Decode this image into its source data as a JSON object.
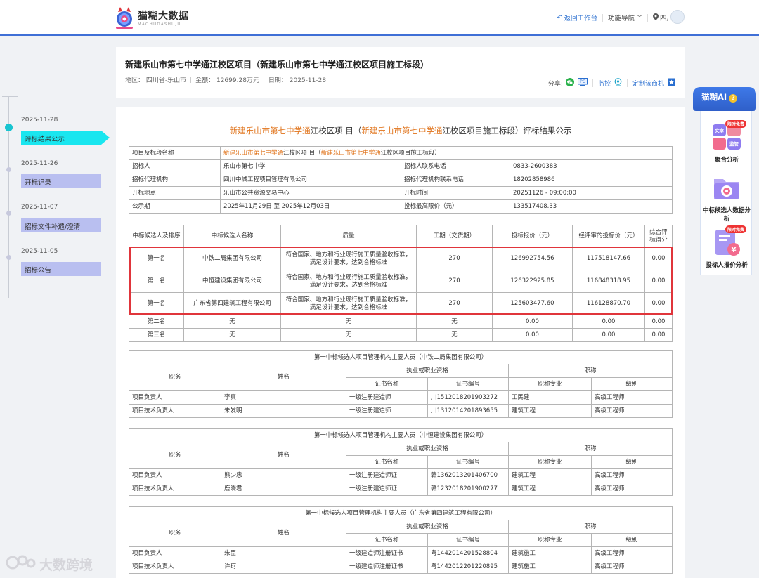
{
  "header": {
    "logo_cn": "猫糊大数据",
    "logo_en": "MAOHUDASHUJU",
    "back_label": "返回工作台",
    "nav_label": "功能导航",
    "region_label": "四川"
  },
  "title_card": {
    "title": "新建乐山市第七中学通江校区项目（新建乐山市第七中学通江校区项目施工标段）",
    "region": "地区： 四川省-乐山市",
    "amount": "金额： 12699.28万元",
    "date": "日期： 2025-11-28",
    "share_label": "分享:",
    "monitor_label": "监控",
    "custom_label": "定制该商机"
  },
  "timeline": [
    {
      "date": "2025-11-28",
      "label": "评标结果公示",
      "active": true
    },
    {
      "date": "2025-11-26",
      "label": "开标记录",
      "active": false
    },
    {
      "date": "2025-11-07",
      "label": "招标文件补遗/澄清",
      "active": false
    },
    {
      "date": "2025-11-05",
      "label": "招标公告",
      "active": false
    }
  ],
  "doc": {
    "title_hl1": "新建乐山市第七中学通",
    "title_mid": "江校区项 目（",
    "title_hl2": "新建乐山市第七中学通",
    "title_end": "江校区项目施工标段）评标结果公示",
    "info": {
      "r1_label": "项目及标段名称",
      "r1_hl1": "新建乐山市第七中学通",
      "r1_mid": "江校区项 目（",
      "r1_hl2": "新建乐山市第七中学通",
      "r1_end": "江校区项目施工标段）",
      "tenderer_label": "招标人",
      "tenderer": "乐山市第七中学",
      "tenderer_phone_label": "招标人联系电话",
      "tenderer_phone": "0833-2600383",
      "agency_label": "招标代理机构",
      "agency": "四川中城工程项目管理有限公司",
      "agency_phone_label": "招标代理机构联系电话",
      "agency_phone": "18202858986",
      "place_label": "开标地点",
      "place": "乐山市公共资源交易中心",
      "time_label": "开标时间",
      "time": "20251126 - 09:00:00",
      "period_label": "公示期",
      "period": "2025年11月29日 至 2025年12月03日",
      "max_label": "投标最高限价（元）",
      "max": "133517408.33"
    },
    "cand_headers": [
      "中标候选人及排序",
      "中标候选人名称",
      "质量",
      "工期（交货期）",
      "投标报价（元）",
      "经评审的投标价（元）",
      "综合评标得分"
    ],
    "cand_rows": [
      [
        "第一名",
        "中铁二局集团有限公司",
        "符合国家、地方和行业现行施工质量验收标准，满足设计要求，达到合格标准",
        "270",
        "126992754.56",
        "117518147.66",
        "0.00"
      ],
      [
        "第一名",
        "中恒建设集团有限公司",
        "符合国家、地方和行业现行施工质量验收标准，满足设计要求，达到合格标准",
        "270",
        "126322925.85",
        "116848318.95",
        "0.00"
      ],
      [
        "第一名",
        "广东省第四建筑工程有限公司",
        "符合国家、地方和行业现行施工质量验收标准，满足设计要求，达到合格标准",
        "270",
        "125603477.60",
        "116128870.70",
        "0.00"
      ],
      [
        "第二名",
        "无",
        "无",
        "无",
        "0.00",
        "0.00",
        "0.00"
      ],
      [
        "第三名",
        "无",
        "无",
        "无",
        "0.00",
        "0.00",
        "0.00"
      ]
    ],
    "staff_headers": {
      "role": "职务",
      "name": "姓名",
      "qual": "执业或职业资格",
      "title": "职称",
      "cert_name": "证书名称",
      "cert_no": "证书编号",
      "major": "职称专业",
      "level": "级别"
    },
    "staff_tables": [
      {
        "caption": "第一中标候选人项目管理机构主要人员（中铁二局集团有限公司）",
        "rows": [
          [
            "项目负责人",
            "李真",
            "一级注册建造师",
            "川1512018201903272",
            "工民建",
            "高级工程师"
          ],
          [
            "项目技术负责人",
            "朱发明",
            "一级注册建造师",
            "川1312014201893655",
            "建筑工程",
            "高级工程师"
          ]
        ]
      },
      {
        "caption": "第一中标候选人项目管理机构主要人员（中恒建设集团有限公司）",
        "rows": [
          [
            "项目负责人",
            "熊少忠",
            "一级注册建造师证",
            "赣1362013201406700",
            "建筑工程",
            "高级工程师"
          ],
          [
            "项目技术负责人",
            "鹿晓君",
            "一级注册建造师证",
            "赣1232018201900277",
            "建筑工程",
            "高级工程师"
          ]
        ]
      },
      {
        "caption": "第一中标候选人项目管理机构主要人员（广东省第四建筑工程有限公司）",
        "rows": [
          [
            "项目负责人",
            "朱臣",
            "一级建造师注册证书",
            "粤1442014201528804",
            "建筑施工",
            "高级工程师"
          ],
          [
            "项目技术负责人",
            "许珂",
            "一级建造师注册证书",
            "粤1442012201220895",
            "建筑施工",
            "高级工程师"
          ]
        ]
      }
    ]
  },
  "ai_panel": {
    "title": "猫糊AI",
    "q": "?",
    "items": [
      {
        "label": "聚合分析",
        "badge": "限时免费",
        "icon_text1": "文章",
        "icon_text2": "监管"
      },
      {
        "label": "中标候选人数据分析",
        "badge": ""
      },
      {
        "label": "投标人报价分析",
        "badge": "限时免费",
        "icon_text": "¥"
      }
    ]
  },
  "watermark": "大数跨境"
}
